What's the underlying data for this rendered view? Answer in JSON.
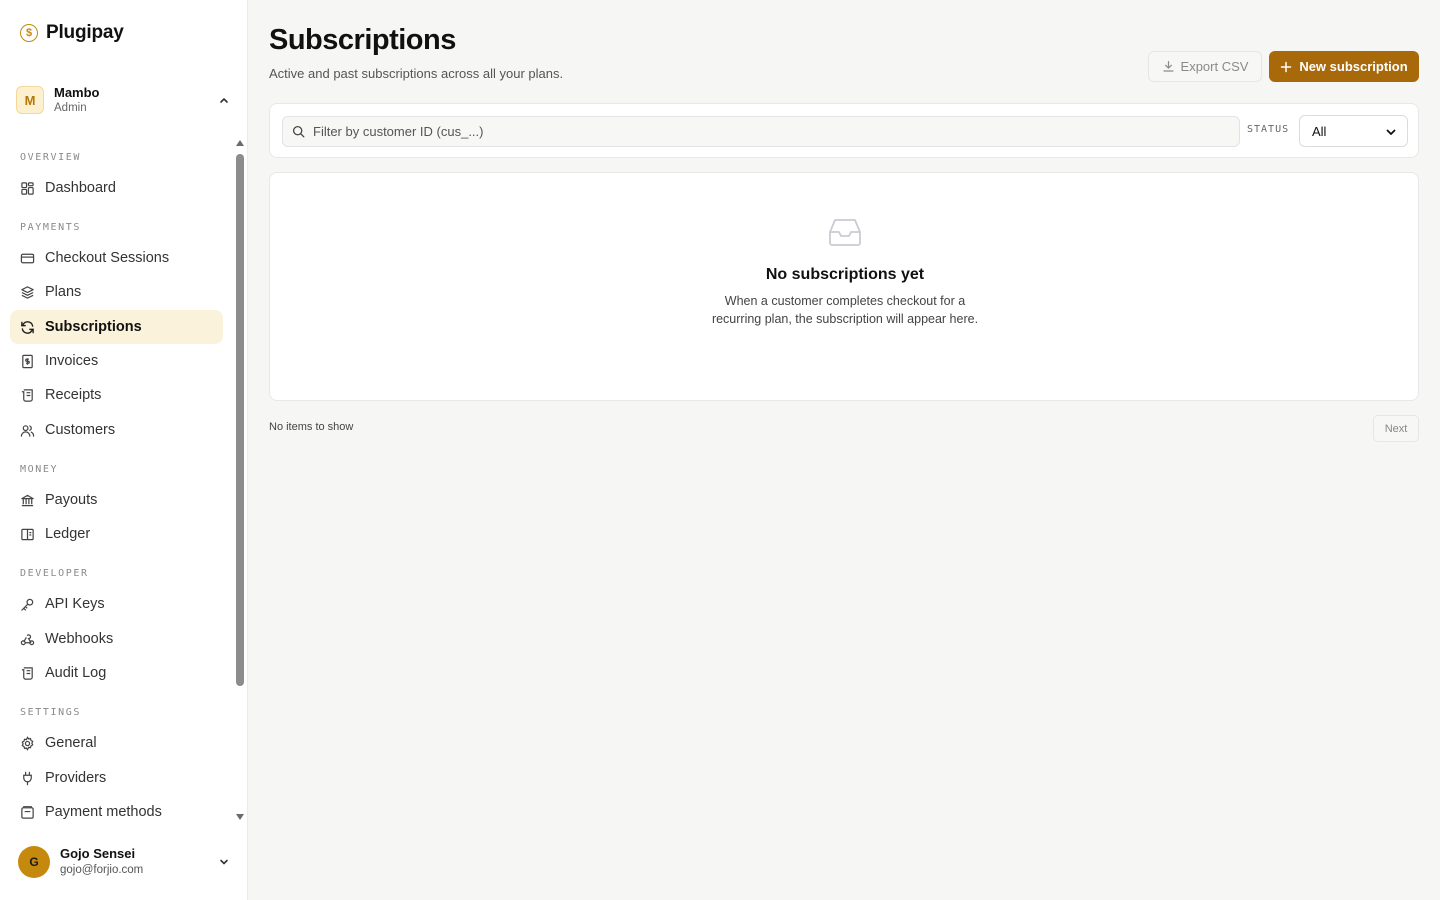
{
  "brand": {
    "name": "Plugipay",
    "logo_glyph": "$"
  },
  "org": {
    "initial": "M",
    "name": "Mambo",
    "role": "Admin"
  },
  "nav": {
    "sections": [
      {
        "label": "OVERVIEW"
      },
      {
        "label": "PAYMENTS"
      },
      {
        "label": "MONEY"
      },
      {
        "label": "DEVELOPER"
      },
      {
        "label": "SETTINGS"
      }
    ],
    "items": [
      {
        "label": "Dashboard",
        "icon": "dashboard-icon"
      },
      {
        "label": "Checkout Sessions",
        "icon": "credit-card-icon"
      },
      {
        "label": "Plans",
        "icon": "layers-icon"
      },
      {
        "label": "Subscriptions",
        "icon": "refresh-icon",
        "active": true
      },
      {
        "label": "Invoices",
        "icon": "invoice-icon"
      },
      {
        "label": "Receipts",
        "icon": "receipt-icon"
      },
      {
        "label": "Customers",
        "icon": "users-icon"
      },
      {
        "label": "Payouts",
        "icon": "bank-icon"
      },
      {
        "label": "Ledger",
        "icon": "book-icon"
      },
      {
        "label": "API Keys",
        "icon": "key-icon"
      },
      {
        "label": "Webhooks",
        "icon": "webhook-icon"
      },
      {
        "label": "Audit Log",
        "icon": "scroll-icon"
      },
      {
        "label": "General",
        "icon": "gear-icon"
      },
      {
        "label": "Providers",
        "icon": "plug-icon"
      },
      {
        "label": "Payment methods",
        "icon": "wallet-icon"
      }
    ]
  },
  "user": {
    "initial": "G",
    "name": "Gojo Sensei",
    "email": "gojo@forjio.com"
  },
  "header": {
    "title": "Subscriptions",
    "subtitle": "Active and past subscriptions across all your plans.",
    "export_label": "Export CSV",
    "new_label": "New subscription"
  },
  "filter": {
    "search_placeholder": "Filter by customer ID (cus_...)",
    "status_label": "STATUS",
    "status_value": "All"
  },
  "empty": {
    "title": "No subscriptions yet",
    "description": "When a customer completes checkout for a recurring plan, the subscription will appear here."
  },
  "pager": {
    "info": "No items to show",
    "next_label": "Next"
  },
  "colors": {
    "accent": "#a8690a",
    "active_bg": "#fbf2dc",
    "brand": "#c4890d"
  }
}
